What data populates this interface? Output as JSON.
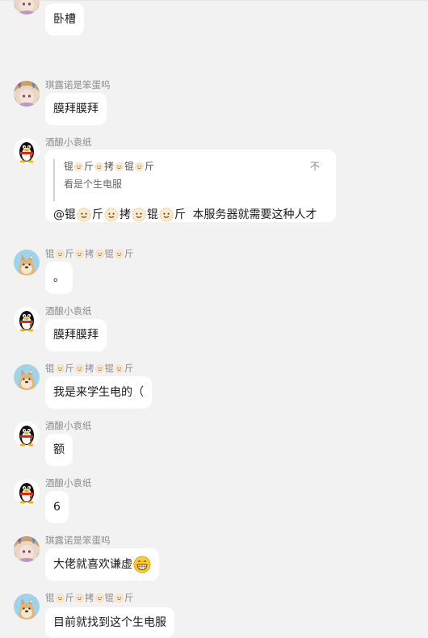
{
  "messages": {
    "m0": {
      "text": "卧槽"
    },
    "m1": {
      "sender": "琪露诺是笨蛋呜",
      "text": "膜拜膜拜"
    },
    "m2": {
      "sender": "酒酿小袁纸",
      "quote": {
        "name_parts": [
          "锟",
          "斤",
          "拷",
          "锟",
          "斤"
        ],
        "text": "看是个生电服",
        "close": "不"
      },
      "mention_parts": [
        "@锟",
        "斤",
        "拷",
        "锟",
        "斤"
      ],
      "text": "本服务器就需要这种人才"
    },
    "m3": {
      "sender_parts": [
        "锟",
        "斤",
        "拷",
        "锟",
        "斤"
      ],
      "text": "。"
    },
    "m4": {
      "sender": "酒酿小袁纸",
      "text": "膜拜膜拜"
    },
    "m5": {
      "sender_parts": [
        "锟",
        "斤",
        "拷",
        "锟",
        "斤"
      ],
      "text": "我是来学生电的（"
    },
    "m6": {
      "sender": "酒酿小袁纸",
      "text": "额"
    },
    "m7": {
      "sender": "酒酿小袁纸",
      "text": "6"
    },
    "m8": {
      "sender": "琪露诺是笨蛋呜",
      "text": "大佬就喜欢谦虚"
    },
    "m9": {
      "sender_parts": [
        "锟",
        "斤",
        "拷",
        "锟",
        "斤"
      ],
      "text": "目前就找到这个生电服"
    }
  },
  "icons": {
    "anime_avatar": "anime-girl-avatar-icon",
    "penguin_avatar": "qq-penguin-avatar-icon",
    "doge_avatar": "doge-avatar-icon",
    "small_emoji": "smiley-emoji-icon",
    "grin_emoji": "grinning-emoji-icon"
  },
  "colors": {
    "background": "#f2f2f2",
    "bubble": "#ffffff",
    "sender": "#8c8c8c"
  }
}
